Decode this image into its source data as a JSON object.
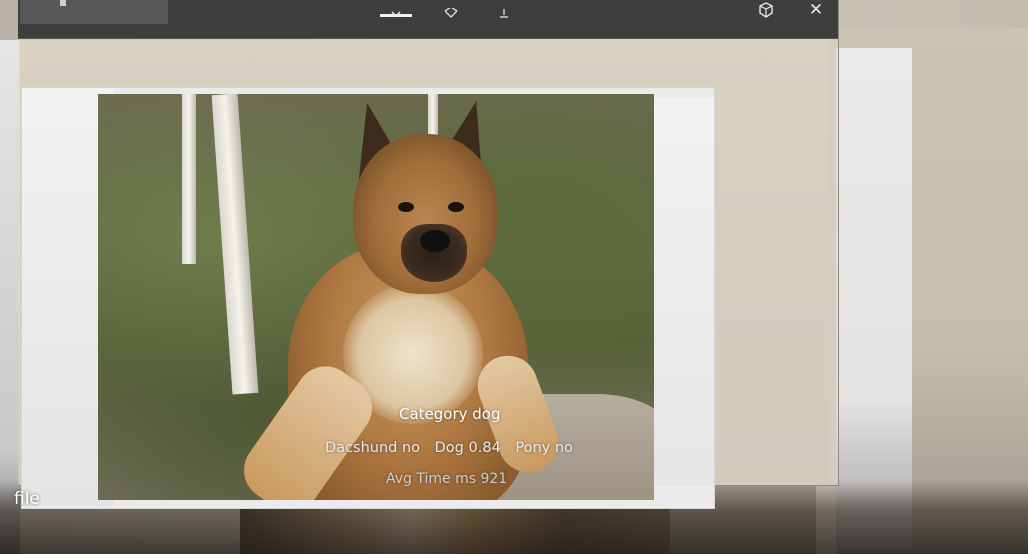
{
  "titlebar": {
    "icons": [
      "capture-icon",
      "focus-icon",
      "mic-icon",
      "mixed-reality-icon",
      "close-icon"
    ],
    "close_glyph": "✕"
  },
  "overlay": {
    "category": "Category dog",
    "results": [
      "Dacshund no",
      "Dog 0.84",
      "Pony no"
    ],
    "time": "Avg Time ms 921"
  },
  "label": {
    "file": "file"
  }
}
